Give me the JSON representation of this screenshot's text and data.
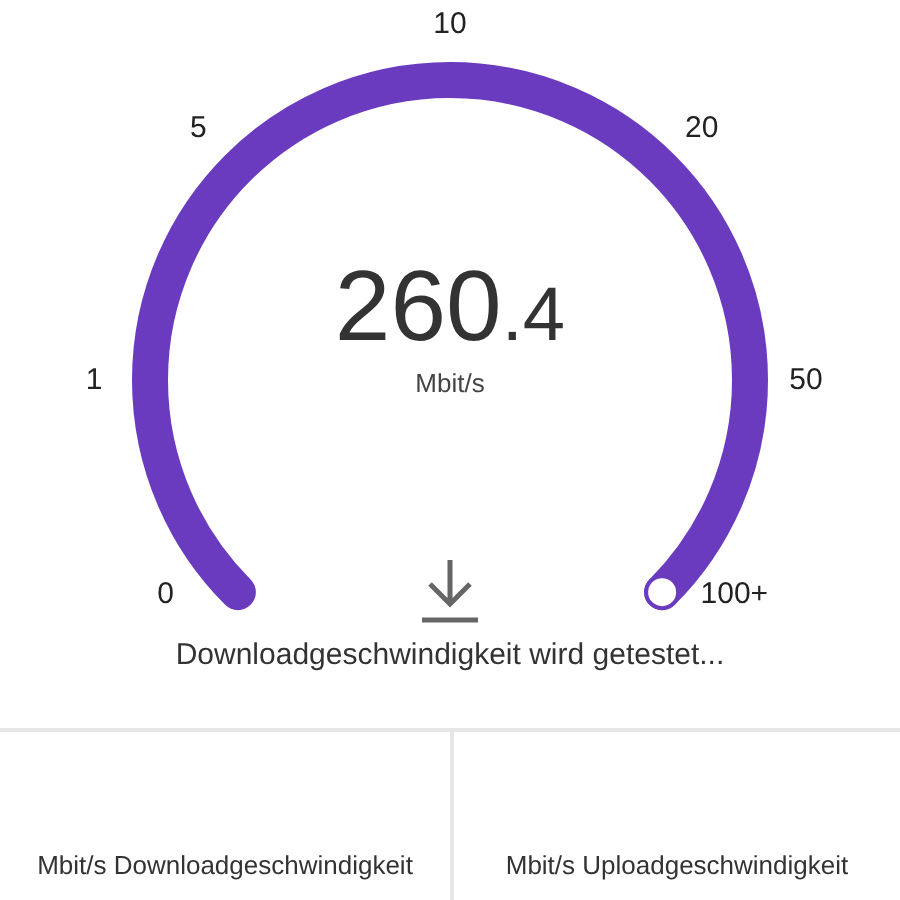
{
  "gauge": {
    "ticks": [
      "0",
      "1",
      "5",
      "10",
      "20",
      "50",
      "100+"
    ]
  },
  "reading": {
    "value_integer": "260",
    "value_decimal": ".4",
    "unit": "Mbit/s"
  },
  "status": "Downloadgeschwindigkeit wird getestet...",
  "results": [
    {
      "label": "Mbit/s Downloadgeschwindigkeit"
    },
    {
      "label": "Mbit/s Uploadgeschwindigkeit"
    }
  ]
}
